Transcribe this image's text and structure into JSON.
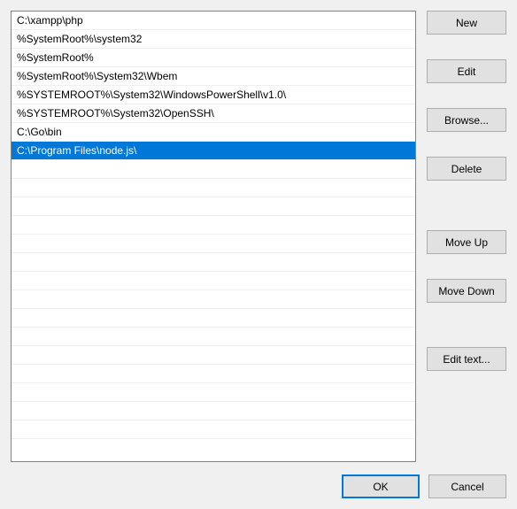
{
  "list": {
    "items": [
      "C:\\xampp\\php",
      "%SystemRoot%\\system32",
      "%SystemRoot%",
      "%SystemRoot%\\System32\\Wbem",
      "%SYSTEMROOT%\\System32\\WindowsPowerShell\\v1.0\\",
      "%SYSTEMROOT%\\System32\\OpenSSH\\",
      "C:\\Go\\bin",
      "C:\\Program Files\\node.js\\"
    ],
    "selectedIndex": 7
  },
  "buttons": {
    "new": "New",
    "edit": "Edit",
    "browse": "Browse...",
    "delete": "Delete",
    "moveUp": "Move Up",
    "moveDown": "Move Down",
    "editText": "Edit text...",
    "ok": "OK",
    "cancel": "Cancel"
  }
}
